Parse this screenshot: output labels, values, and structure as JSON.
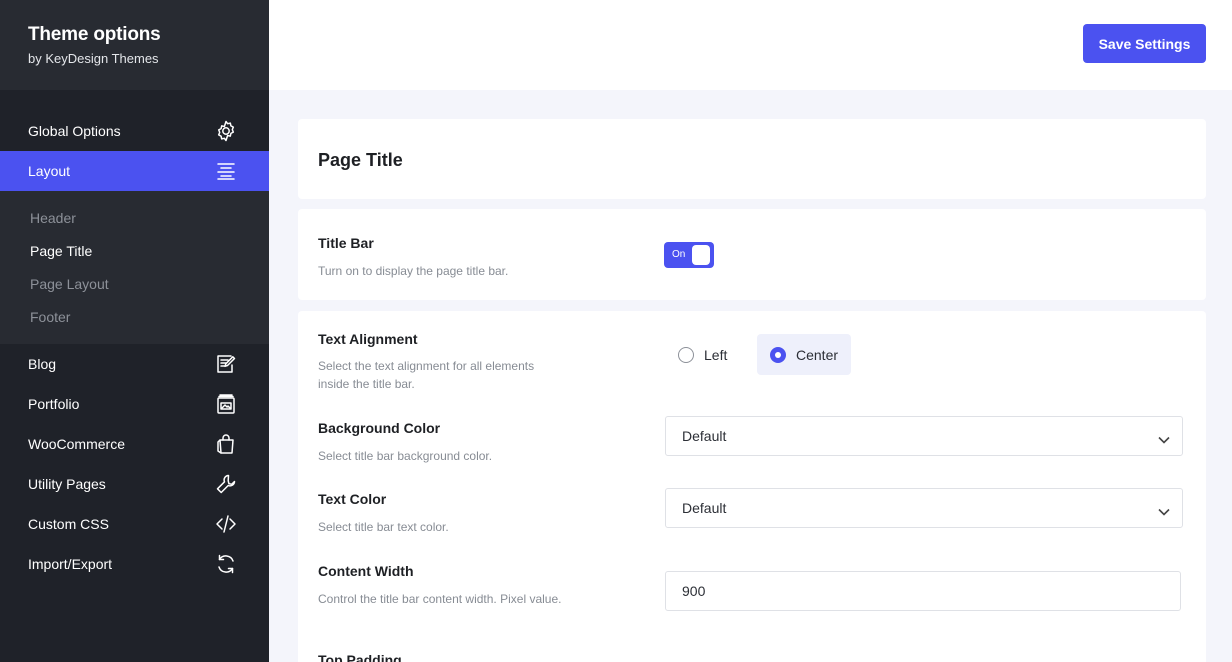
{
  "brand": {
    "title": "Theme options",
    "subtitle": "by KeyDesign Themes"
  },
  "header": {
    "save_label": "Save Settings"
  },
  "sidebar": {
    "items_top": [
      {
        "label": "Global Options",
        "icon": "gear-icon"
      },
      {
        "label": "Layout",
        "icon": "align-center-icon",
        "active": true
      }
    ],
    "subitems": [
      {
        "label": "Header"
      },
      {
        "label": "Page Title",
        "active": true
      },
      {
        "label": "Page Layout"
      },
      {
        "label": "Footer"
      }
    ],
    "items_bottom": [
      {
        "label": "Blog",
        "icon": "edit-note-icon"
      },
      {
        "label": "Portfolio",
        "icon": "portfolio-icon"
      },
      {
        "label": "WooCommerce",
        "icon": "shopping-bag-icon"
      },
      {
        "label": "Utility Pages",
        "icon": "wrench-icon"
      },
      {
        "label": "Custom CSS",
        "icon": "code-icon"
      },
      {
        "label": "Import/Export",
        "icon": "sync-icon"
      }
    ]
  },
  "main": {
    "section_title": "Page Title",
    "title_bar": {
      "label": "Title Bar",
      "description": "Turn on to display the page title bar.",
      "toggle_label": "On",
      "enabled": true
    },
    "text_alignment": {
      "label": "Text Alignment",
      "description": "Select the text alignment for all elements inside the title bar.",
      "options": [
        "Left",
        "Center"
      ],
      "selected": "Center"
    },
    "background_color": {
      "label": "Background Color",
      "description": "Select title bar background color.",
      "value": "Default"
    },
    "text_color": {
      "label": "Text Color",
      "description": "Select title bar text color.",
      "value": "Default"
    },
    "content_width": {
      "label": "Content Width",
      "description": "Control the title bar content width. Pixel value.",
      "value": "900"
    },
    "top_padding": {
      "label": "Top Padding"
    }
  },
  "colors": {
    "accent": "#4b52f0",
    "sidebar_bg": "#1f2229",
    "sidebar_sub_bg": "#282b32",
    "page_bg": "#f4f5fb"
  }
}
